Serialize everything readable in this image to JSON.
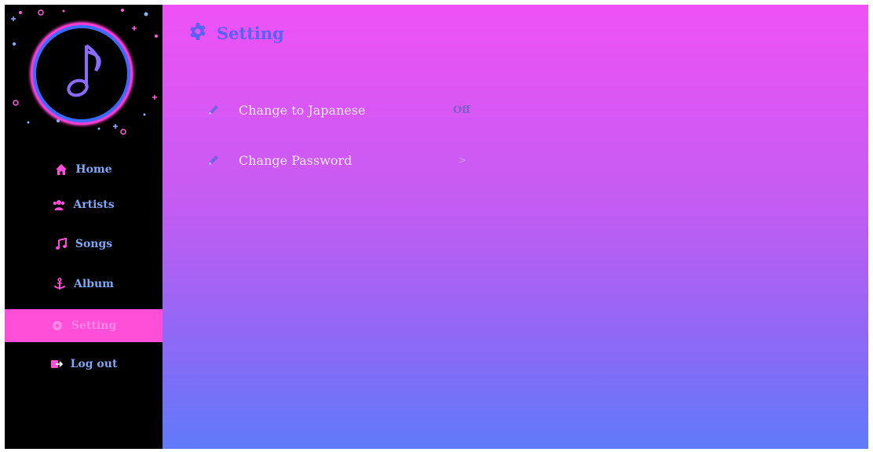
{
  "colors": {
    "sidebar_bg": "#000000",
    "nav_text": "#7fa7f5",
    "nav_active_bg": "#ff4fd8",
    "title_color": "#5a63f0",
    "gradient_top": "#ef52f6",
    "gradient_bottom": "#5f7af8"
  },
  "sidebar": {
    "logo_icon": "music-note-icon",
    "items": [
      {
        "label": "Home",
        "icon": "home-icon",
        "active": false
      },
      {
        "label": "Artists",
        "icon": "users-icon",
        "active": false
      },
      {
        "label": "Songs",
        "icon": "music-icon",
        "active": false
      },
      {
        "label": "Album",
        "icon": "anchor-icon",
        "active": false
      },
      {
        "label": "Setting",
        "icon": "gear-icon",
        "active": true
      },
      {
        "label": "Log out",
        "icon": "logout-icon",
        "active": false
      }
    ]
  },
  "header": {
    "title": "Setting",
    "icon": "gear-icon"
  },
  "settings": {
    "rows": [
      {
        "label": "Change to Japanese",
        "value": "Off",
        "icon": "pencil-icon"
      },
      {
        "label": "Change Password",
        "value": ">",
        "icon": "pencil-icon"
      }
    ]
  }
}
